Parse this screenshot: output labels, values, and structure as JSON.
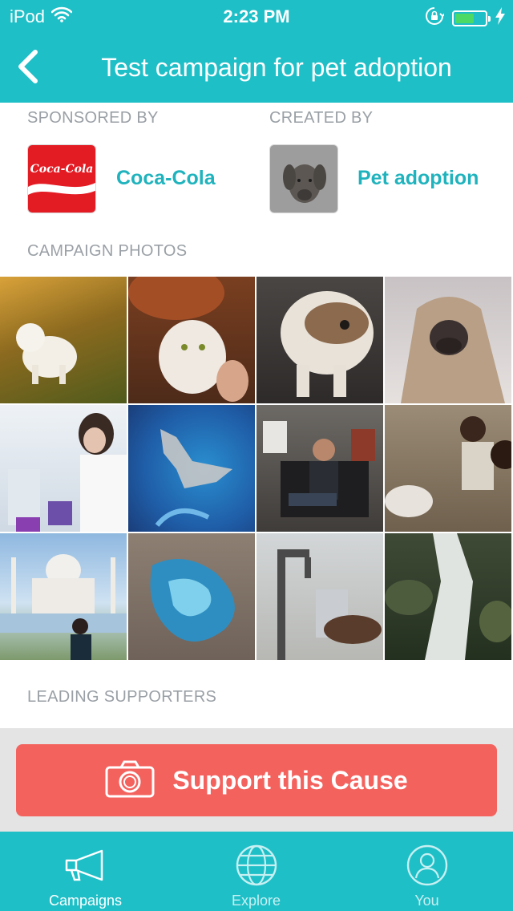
{
  "status_bar": {
    "carrier": "iPod",
    "time": "2:23 PM",
    "wifi_icon": "wifi-icon",
    "lock_icon": "rotation-lock-icon",
    "battery_icon": "battery-icon",
    "charging_icon": "charging-bolt-icon",
    "battery_level": 0.64
  },
  "nav": {
    "back_icon": "chevron-left-icon",
    "title": "Test campaign for pet adoption"
  },
  "sponsor": {
    "label": "SPONSORED BY",
    "name": "Coca-Cola",
    "logo_text": "Coca-Cola"
  },
  "creator": {
    "label": "CREATED BY",
    "name": "Pet adoption"
  },
  "photos": {
    "label": "CAMPAIGN PHOTOS",
    "items": [
      "white dog on grass",
      "girl holding white cat",
      "bulldog",
      "pug in blanket",
      "lab scientist",
      "satellite view of island",
      "man sitting on chair",
      "children with water bowl",
      "Taj Mahal with visitor",
      "aerial view of blue lake",
      "water tap filling glass",
      "waterfall in forest"
    ]
  },
  "supporters": {
    "label": "LEADING SUPPORTERS"
  },
  "support_button": {
    "label": "Support this Cause",
    "icon": "camera-icon"
  },
  "tabs": [
    {
      "label": "Campaigns",
      "icon": "megaphone-icon",
      "active": true
    },
    {
      "label": "Explore",
      "icon": "globe-icon",
      "active": false
    },
    {
      "label": "You",
      "icon": "user-icon",
      "active": false
    }
  ],
  "colors": {
    "brand": "#1fbfc7",
    "accent_text": "#1fb3bd",
    "button": "#f4625e",
    "label_gray": "#9aa0a6",
    "tab_inactive": "#c6f0f2"
  }
}
